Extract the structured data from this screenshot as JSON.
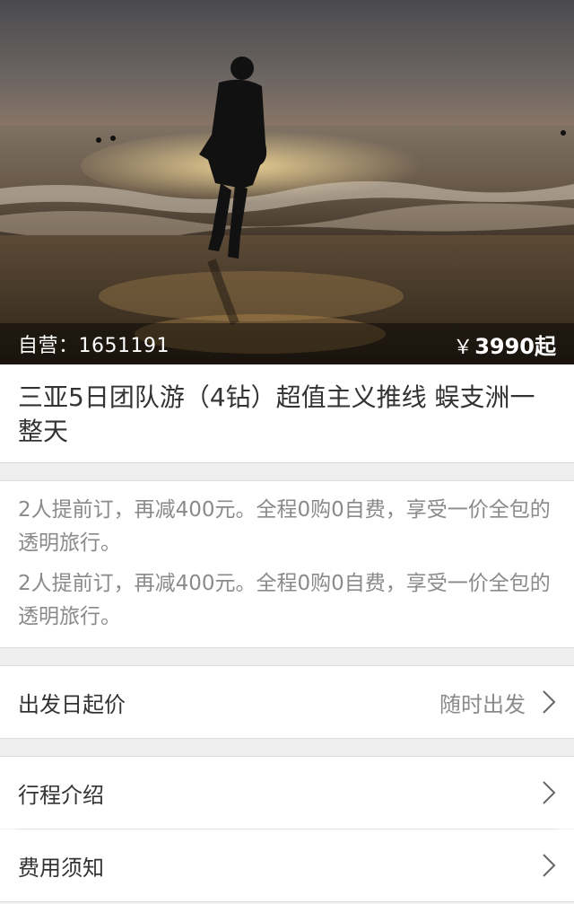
{
  "hero": {
    "product_code": "自营：1651191",
    "currency": "￥",
    "price": "3990起"
  },
  "title": "三亚5日团队游（4钻）超值主义推线 蜈支洲一整天",
  "promos": [
    "2人提前订，再减400元。全程0购0自费，享受一价全包的透明旅行。",
    "2人提前订，再减400元。全程0购0自费，享受一价全包的透明旅行。"
  ],
  "departure": {
    "label": "出发日起价",
    "value": "随时出发"
  },
  "menu": [
    {
      "label": "行程介绍"
    },
    {
      "label": "费用须知"
    }
  ],
  "colors": {
    "background": "#f2f2f2",
    "text_primary": "#333333",
    "text_secondary": "#8a8a8a",
    "overlay": "rgba(0,0,0,0.45)"
  }
}
